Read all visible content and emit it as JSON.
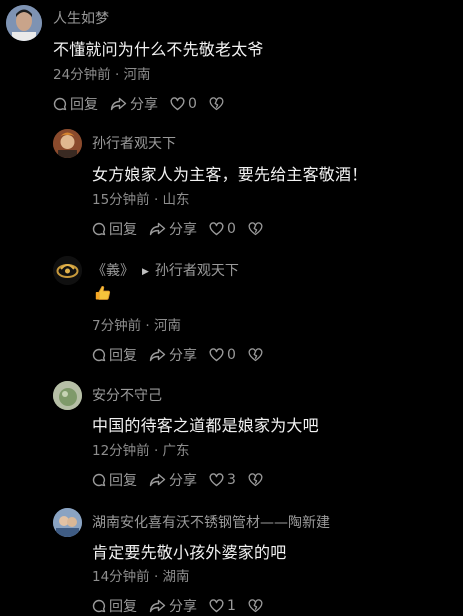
{
  "comments": [
    {
      "user": "人生如梦",
      "text": "不懂就问为什么不先敬老太爷",
      "meta": "24分钟前 · 河南",
      "reply_label": "回复",
      "share_label": "分享",
      "likes": "0"
    },
    {
      "user": "孙行者观天下",
      "text": "女方娘家人为主客，要先给主客敬酒！",
      "meta": "15分钟前 · 山东",
      "reply_label": "回复",
      "share_label": "分享",
      "likes": "0"
    },
    {
      "user": "《義》",
      "reply_to": "孙行者观天下",
      "text_icon": "thumbs-up-emoji",
      "meta": "7分钟前 · 河南",
      "reply_label": "回复",
      "share_label": "分享",
      "likes": "0"
    },
    {
      "user": "安分不守己",
      "text": "中国的待客之道都是娘家为大吧",
      "meta": "12分钟前 · 广东",
      "reply_label": "回复",
      "share_label": "分享",
      "likes": "3"
    },
    {
      "user": "湖南安化喜有沃不锈钢管材——陶新建",
      "text": "肯定要先敬小孩外婆家的吧",
      "meta": "14分钟前 · 湖南",
      "reply_label": "回复",
      "share_label": "分享",
      "likes": "1"
    }
  ],
  "colors": {
    "background": "#000000",
    "text": "#f2f2f2",
    "secondary": "#8e8e8e"
  }
}
